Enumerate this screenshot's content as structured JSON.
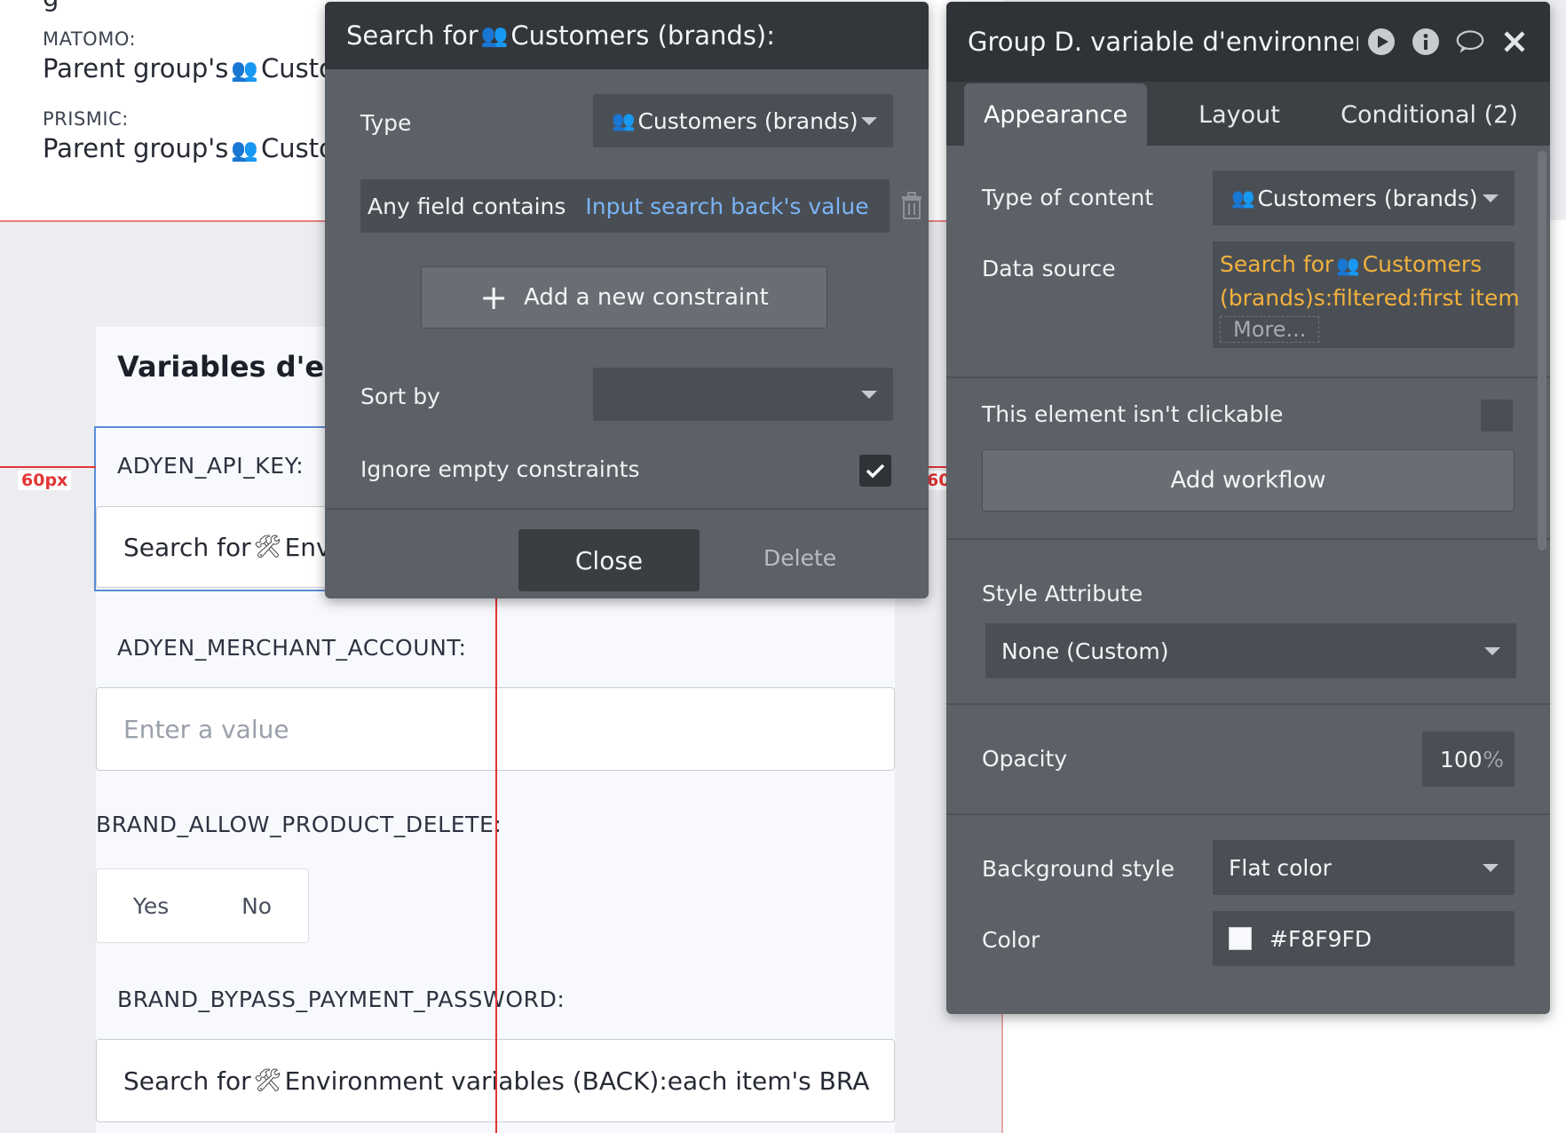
{
  "canvas": {
    "top_card": {
      "groups": [
        {
          "label": "MATOMO:",
          "value_prefix": "Parent group's",
          "value_suffix": "Custo"
        },
        {
          "label": "PRISMIC:",
          "value_prefix": "Parent group's",
          "value_suffix": "Custo"
        }
      ]
    },
    "card_title": "Variables d'env",
    "spacing_tag": "60px",
    "spacing_tag_right": "60",
    "fields": [
      {
        "label": "ADYEN_API_KEY:",
        "value_prefix": "Search for",
        "value_suffix": "Env",
        "placeholder": ""
      },
      {
        "label": "ADYEN_MERCHANT_ACCOUNT:",
        "value": "",
        "placeholder": "Enter a value"
      },
      {
        "label": "BRAND_ALLOW_PRODUCT_DELETE:",
        "options": [
          "Yes",
          "No"
        ]
      },
      {
        "label": "BRAND_BYPASS_PAYMENT_PASSWORD:",
        "value_prefix": "Search for",
        "value_suffix": "Environment variables (BACK):each item's BRA"
      }
    ]
  },
  "search_popup": {
    "title_prefix": "Search for",
    "title_suffix": "Customers (brands):",
    "type_label": "Type",
    "type_value": "Customers (brands)",
    "constraint": {
      "field": "Any field contains",
      "value": "Input search back's value"
    },
    "add_constraint_label": "Add a new constraint",
    "sort_by_label": "Sort by",
    "sort_by_value": "",
    "ignore_empty_label": "Ignore empty constraints",
    "ignore_empty_checked": true,
    "close_label": "Close",
    "delete_label": "Delete"
  },
  "property_editor": {
    "title": "Group D. variable d'environneme",
    "tabs": [
      {
        "label": "Appearance",
        "active": true
      },
      {
        "label": "Layout",
        "active": false
      },
      {
        "label": "Conditional (2)",
        "active": false
      }
    ],
    "type_of_content_label": "Type of content",
    "type_of_content_value": "Customers (brands)",
    "data_source_label": "Data source",
    "data_source_prefix": "Search for",
    "data_source_line1_suffix": "Customers",
    "data_source_line2": "(brands)s:filtered:first item",
    "more_label": "More...",
    "not_clickable_label": "This element isn't clickable",
    "add_workflow_label": "Add workflow",
    "style_attribute_label": "Style Attribute",
    "style_attribute_value": "None (Custom)",
    "opacity_label": "Opacity",
    "opacity_value": "100",
    "opacity_unit": "%",
    "background_style_label": "Background style",
    "background_style_value": "Flat color",
    "color_label": "Color",
    "color_value": "#F8F9FD"
  },
  "colors": {
    "panel": "#5b6167",
    "panel_header": "#33373b",
    "link": "#7ab4f5",
    "data_source": "#f2b13c",
    "guide_line": "#e33535"
  }
}
